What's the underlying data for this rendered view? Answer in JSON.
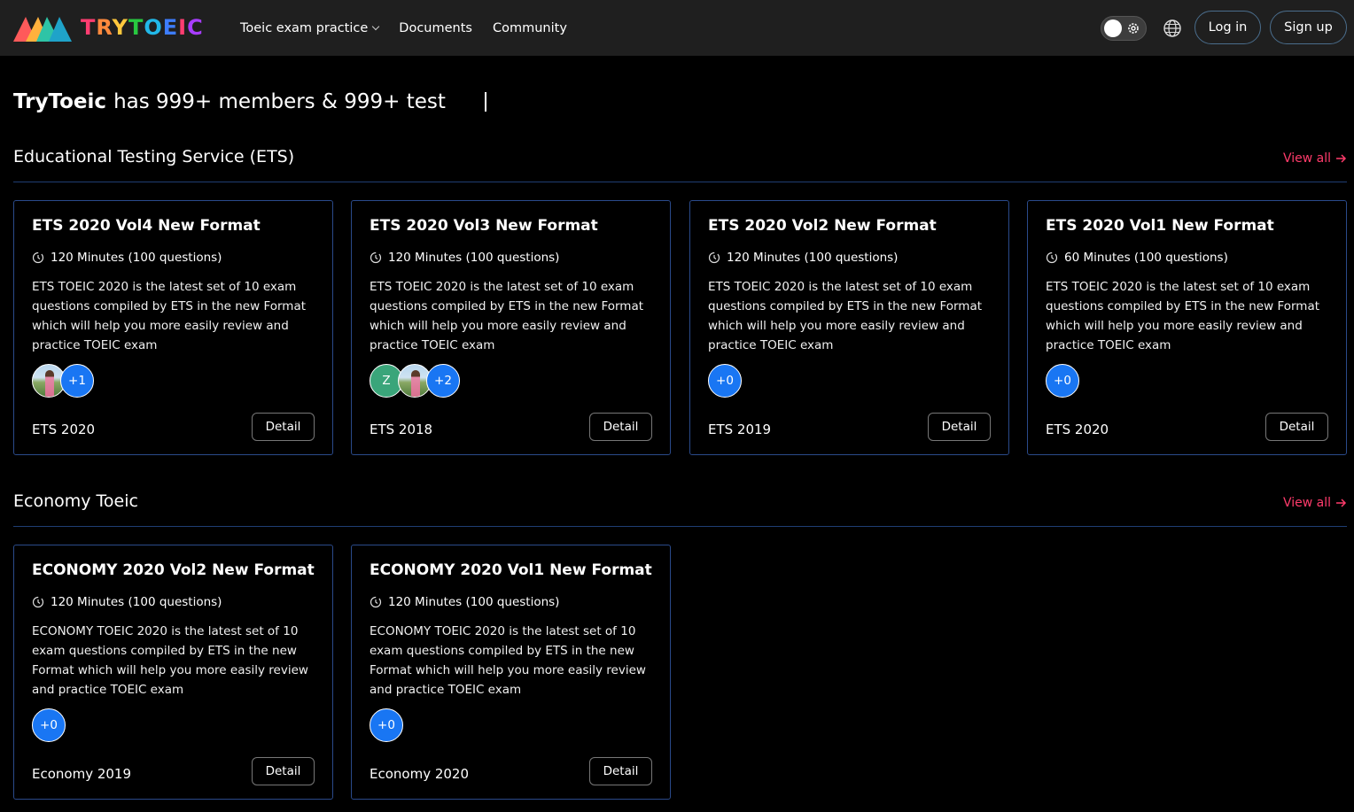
{
  "navbar": {
    "logo_text": "TRYTOEIC",
    "logo_letter_colors": [
      "#ff3d71",
      "#ff8a3d",
      "#ffc83d",
      "#28c840",
      "#22b8e8",
      "#3d7dff",
      "#ff3d71",
      "#a83dff"
    ],
    "links": [
      {
        "label": "Toeic exam practice",
        "has_dropdown": true
      },
      {
        "label": "Documents",
        "has_dropdown": false
      },
      {
        "label": "Community",
        "has_dropdown": false
      }
    ],
    "login_label": "Log in",
    "signup_label": "Sign up"
  },
  "hero": {
    "brand": "TryToeic",
    "text": "has 999+ members & 999+ test"
  },
  "sections": [
    {
      "title": "Educational Testing Service (ETS)",
      "view_all": "View all",
      "cards": [
        {
          "title": "ETS 2020 Vol4 New Format",
          "duration": "120 Minutes (100 questions)",
          "description": "ETS TOEIC 2020 is the latest set of 10 exam questions compiled by ETS in the new Format which will help you more easily review and practice TOEIC exam",
          "avatars": [
            "photo"
          ],
          "count": "+1",
          "tag": "ETS 2020",
          "detail": "Detail"
        },
        {
          "title": "ETS 2020 Vol3 New Format",
          "duration": "120 Minutes (100 questions)",
          "description": "ETS TOEIC 2020 is the latest set of 10 exam questions compiled by ETS in the new Format which will help you more easily review and practice TOEIC exam",
          "avatars": [
            "Z",
            "photo"
          ],
          "count": "+2",
          "tag": "ETS 2018",
          "detail": "Detail"
        },
        {
          "title": "ETS 2020 Vol2 New Format",
          "duration": "120 Minutes (100 questions)",
          "description": "ETS TOEIC 2020 is the latest set of 10 exam questions compiled by ETS in the new Format which will help you more easily review and practice TOEIC exam",
          "avatars": [],
          "count": "+0",
          "tag": "ETS 2019",
          "detail": "Detail"
        },
        {
          "title": "ETS 2020 Vol1 New Format",
          "duration": "60 Minutes (100 questions)",
          "description": "ETS TOEIC 2020 is the latest set of 10 exam questions compiled by ETS in the new Format which will help you more easily review and practice TOEIC exam",
          "avatars": [],
          "count": "+0",
          "tag": "ETS 2020",
          "detail": "Detail"
        }
      ]
    },
    {
      "title": "Economy Toeic",
      "view_all": "View all",
      "cards": [
        {
          "title": "ECONOMY 2020 Vol2 New Format",
          "duration": "120 Minutes (100 questions)",
          "description": "ECONOMY TOEIC 2020 is the latest set of 10 exam questions compiled by ETS in the new Format which will help you more easily review and practice TOEIC exam",
          "avatars": [],
          "count": "+0",
          "tag": "Economy 2019",
          "detail": "Detail"
        },
        {
          "title": "ECONOMY 2020 Vol1 New Format",
          "duration": "120 Minutes (100 questions)",
          "description": "ECONOMY TOEIC 2020 is the latest set of 10 exam questions compiled by ETS in the new Format which will help you more easily review and practice TOEIC exam",
          "avatars": [],
          "count": "+0",
          "tag": "Economy 2020",
          "detail": "Detail"
        }
      ]
    }
  ],
  "colors": {
    "navbar_bg": "#1f1f1f",
    "page_bg": "#000000",
    "card_border": "#2a4a8a",
    "view_all": "#ff3b6b",
    "avatar_count_bg": "#1976f3",
    "avatar_letter_bg": "#3aa57a"
  },
  "icons": {
    "clock": "clock-icon",
    "arrow": "arrow-right-icon",
    "globe": "globe-icon",
    "gear": "gear-icon",
    "chevron": "chevron-down-icon"
  }
}
